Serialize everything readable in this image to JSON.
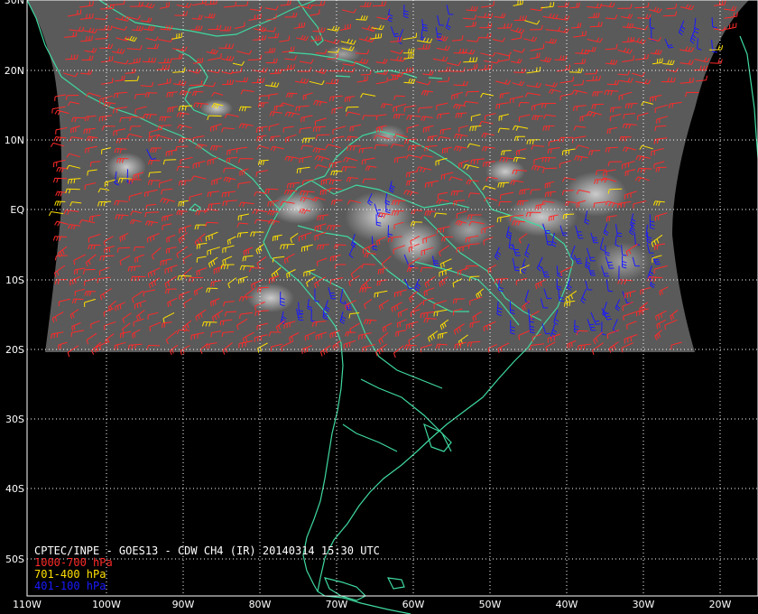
{
  "map": {
    "title": "CPTEC/INPE - GOES13 - CDW CH4 (IR) 20140314 15:30 UTC",
    "legend": [
      {
        "label": "1000-700 hPa",
        "color": "#ff2a2a"
      },
      {
        "label": "701-400 hPa",
        "color": "#ffe000"
      },
      {
        "label": "401-100 hPa",
        "color": "#1a1aff"
      }
    ],
    "lat_labels": [
      "30N",
      "20N",
      "10N",
      "EQ",
      "10S",
      "20S",
      "30S",
      "40S",
      "50S"
    ],
    "lon_labels": [
      "110W",
      "100W",
      "90W",
      "80W",
      "70W",
      "60W",
      "50W",
      "40W",
      "30W",
      "20W"
    ],
    "colors": {
      "background": "#000000",
      "coastline": "#3fd9a0",
      "grid": "#ffffff",
      "satellite_backdrop": "#5a5a5a"
    }
  }
}
